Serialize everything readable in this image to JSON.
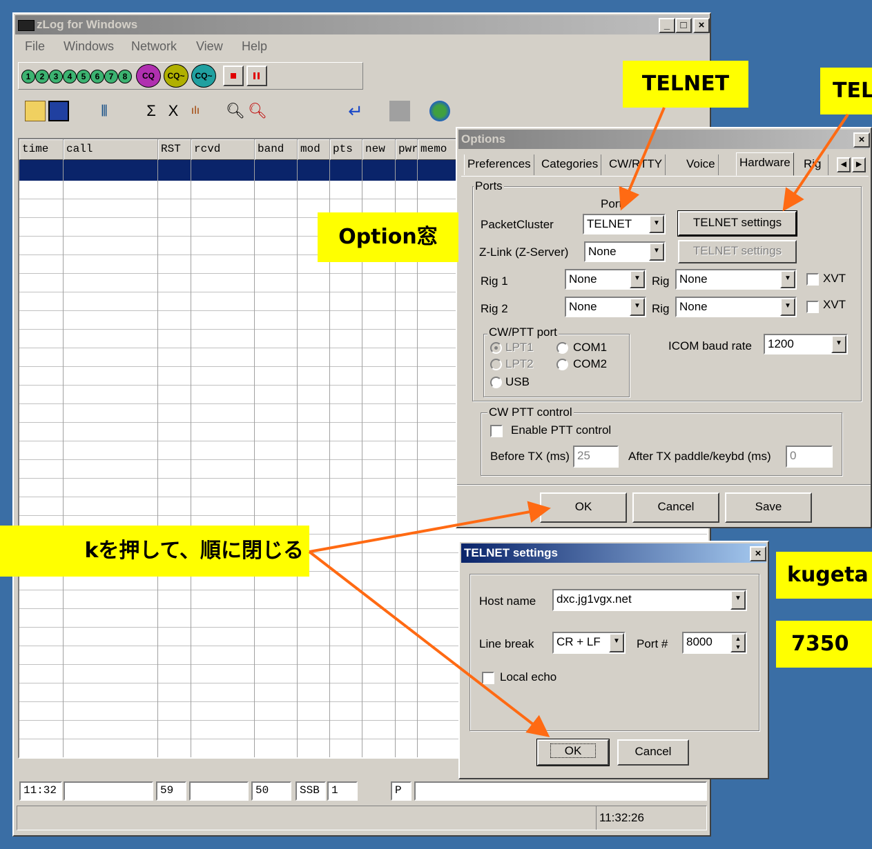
{
  "main_window": {
    "title": "zLog for Windows",
    "menu": [
      "File",
      "Windows",
      "Network",
      "View",
      "Help"
    ],
    "cq_buttons": [
      "1",
      "2",
      "3",
      "4",
      "5",
      "6",
      "7",
      "8"
    ],
    "cq_labels": [
      "CQ",
      "CQ~",
      "CQ~"
    ],
    "columns": [
      "time",
      "call",
      "RST",
      "rcvd",
      "band",
      "mod",
      "pts",
      "new",
      "pwr",
      "memo"
    ],
    "entry": {
      "time": "11:32",
      "call": "",
      "rst": "59",
      "rcvd": "",
      "band": "50",
      "mode": "SSB",
      "pts": "1",
      "pwr": "P",
      "memo": ""
    },
    "status_clock": "11:32:26",
    "colors": {
      "selected_row": "#0a246a",
      "desktop": "#3a6ea5"
    }
  },
  "options": {
    "title": "Options",
    "tabs": [
      "Preferences",
      "Categories",
      "CW/RTTY",
      "Voice",
      "Hardware",
      "Rig"
    ],
    "active_tab": "Hardware",
    "ports_label": "Ports",
    "port_col_label": "Port",
    "packet_cluster_label": "PacketCluster",
    "packet_cluster_value": "TELNET",
    "telnet_settings_label": "TELNET settings",
    "zlink_label": "Z-Link (Z-Server)",
    "zlink_value": "None",
    "rig1_label": "Rig 1",
    "rig2_label": "Rig 2",
    "rig_port_value": "None",
    "rig_label": "Rig",
    "rig_value": "None",
    "xvt_label": "XVT",
    "cwptt_port_label": "CW/PTT port",
    "lpt1": "LPT1",
    "lpt2": "LPT2",
    "com1": "COM1",
    "com2": "COM2",
    "usb": "USB",
    "icom_baud_label": "ICOM baud rate",
    "icom_baud_value": "1200",
    "cw_ptt_control_label": "CW PTT control",
    "enable_ptt_label": "Enable PTT control",
    "before_tx_label": "Before TX (ms)",
    "before_tx_value": "25",
    "after_tx_label": "After TX paddle/keybd (ms)",
    "after_tx_value": "0",
    "ok": "OK",
    "cancel": "Cancel",
    "save": "Save"
  },
  "telnet": {
    "title": "TELNET settings",
    "host_label": "Host name",
    "host_value": "dxc.jg1vgx.net",
    "line_break_label": "Line break",
    "line_break_value": "CR + LF",
    "port_label": "Port #",
    "port_value": "8000",
    "local_echo_label": "Local echo",
    "ok": "OK",
    "cancel": "Cancel"
  },
  "callouts": {
    "telnet1": "TELNET",
    "telnet2": "TEL",
    "option_window": "Option窓",
    "close_order": "kを押して、順に閉じる",
    "kugeta": "kugeta",
    "port_7350": "7350"
  },
  "arrow_color": "#ff6a13"
}
